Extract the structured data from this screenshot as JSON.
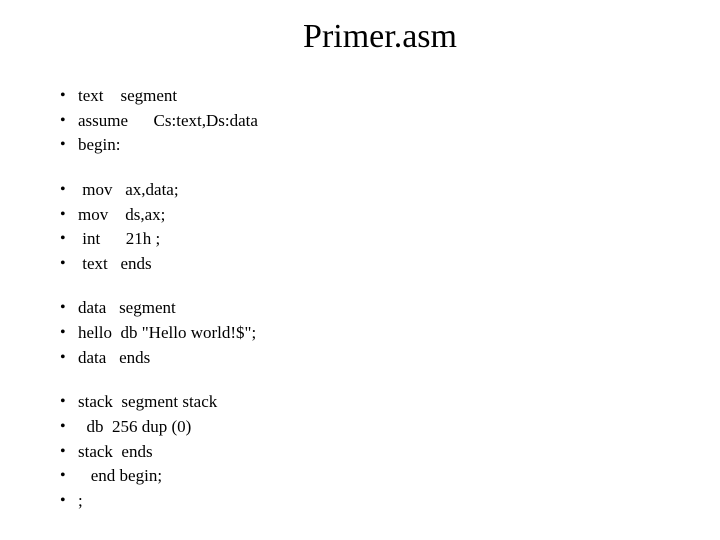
{
  "title": "Primer.asm",
  "lines": [
    "text    segment",
    "assume      Cs:text,Ds:data",
    "begin:",
    "",
    " mov   ax,data;",
    "mov    ds,ax;",
    " int      21h ;",
    " text   ends",
    "",
    "data   segment",
    "hello  db \"Hello world!$\";",
    "data   ends",
    "",
    "stack  segment stack",
    "  db  256 dup (0)",
    "stack  ends",
    "   end begin;",
    ";"
  ]
}
